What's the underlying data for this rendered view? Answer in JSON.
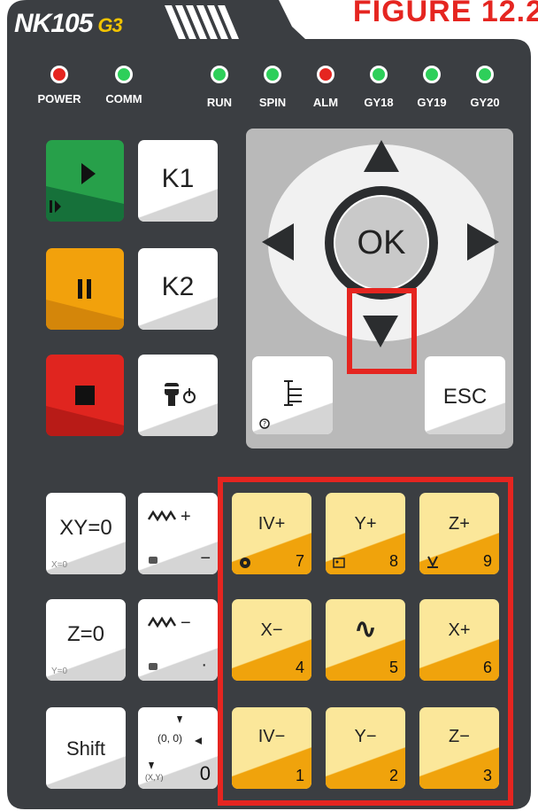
{
  "figure_label": "FIGURE 12.2",
  "brand": {
    "name": "NK105",
    "model": "G3"
  },
  "leds": [
    {
      "label": "POWER",
      "color": "#e52520"
    },
    {
      "label": "COMM",
      "color": "#2ecf5a"
    },
    {
      "label": "RUN",
      "color": "#2ecf5a"
    },
    {
      "label": "SPIN",
      "color": "#2ecf5a"
    },
    {
      "label": "ALM",
      "color": "#e52520"
    },
    {
      "label": "GY18",
      "color": "#2ecf5a"
    },
    {
      "label": "GY19",
      "color": "#2ecf5a"
    },
    {
      "label": "GY20",
      "color": "#2ecf5a"
    }
  ],
  "keys": {
    "k1": "K1",
    "k2": "K2",
    "esc": "ESC",
    "ok": "OK",
    "xy0": "XY=0",
    "xy0_sub": "X=0",
    "z0": "Z=0",
    "z0_sub": "Y=0",
    "shift": "Shift",
    "speed_up": "+",
    "speed_up_alt": "−",
    "speed_down": "−",
    "speed_down_alt": "·",
    "origin_label": "(0, 0)",
    "origin_num": "0",
    "origin_sub": "(X,Y)",
    "jog": [
      {
        "label": "IV+",
        "num": "7"
      },
      {
        "label": "Y+",
        "num": "8"
      },
      {
        "label": "Z+",
        "num": "9"
      },
      {
        "label": "X−",
        "num": "4"
      },
      {
        "label": "∿",
        "num": "5"
      },
      {
        "label": "X+",
        "num": "6"
      },
      {
        "label": "IV−",
        "num": "1"
      },
      {
        "label": "Y−",
        "num": "2"
      },
      {
        "label": "Z−",
        "num": "3"
      }
    ]
  },
  "colors": {
    "body": "#3b3e42",
    "start": "#1f8a3b",
    "pause": "#f2a10c",
    "stop": "#e0251f",
    "jog": "#fbe79a",
    "highlight": "#e52520"
  }
}
